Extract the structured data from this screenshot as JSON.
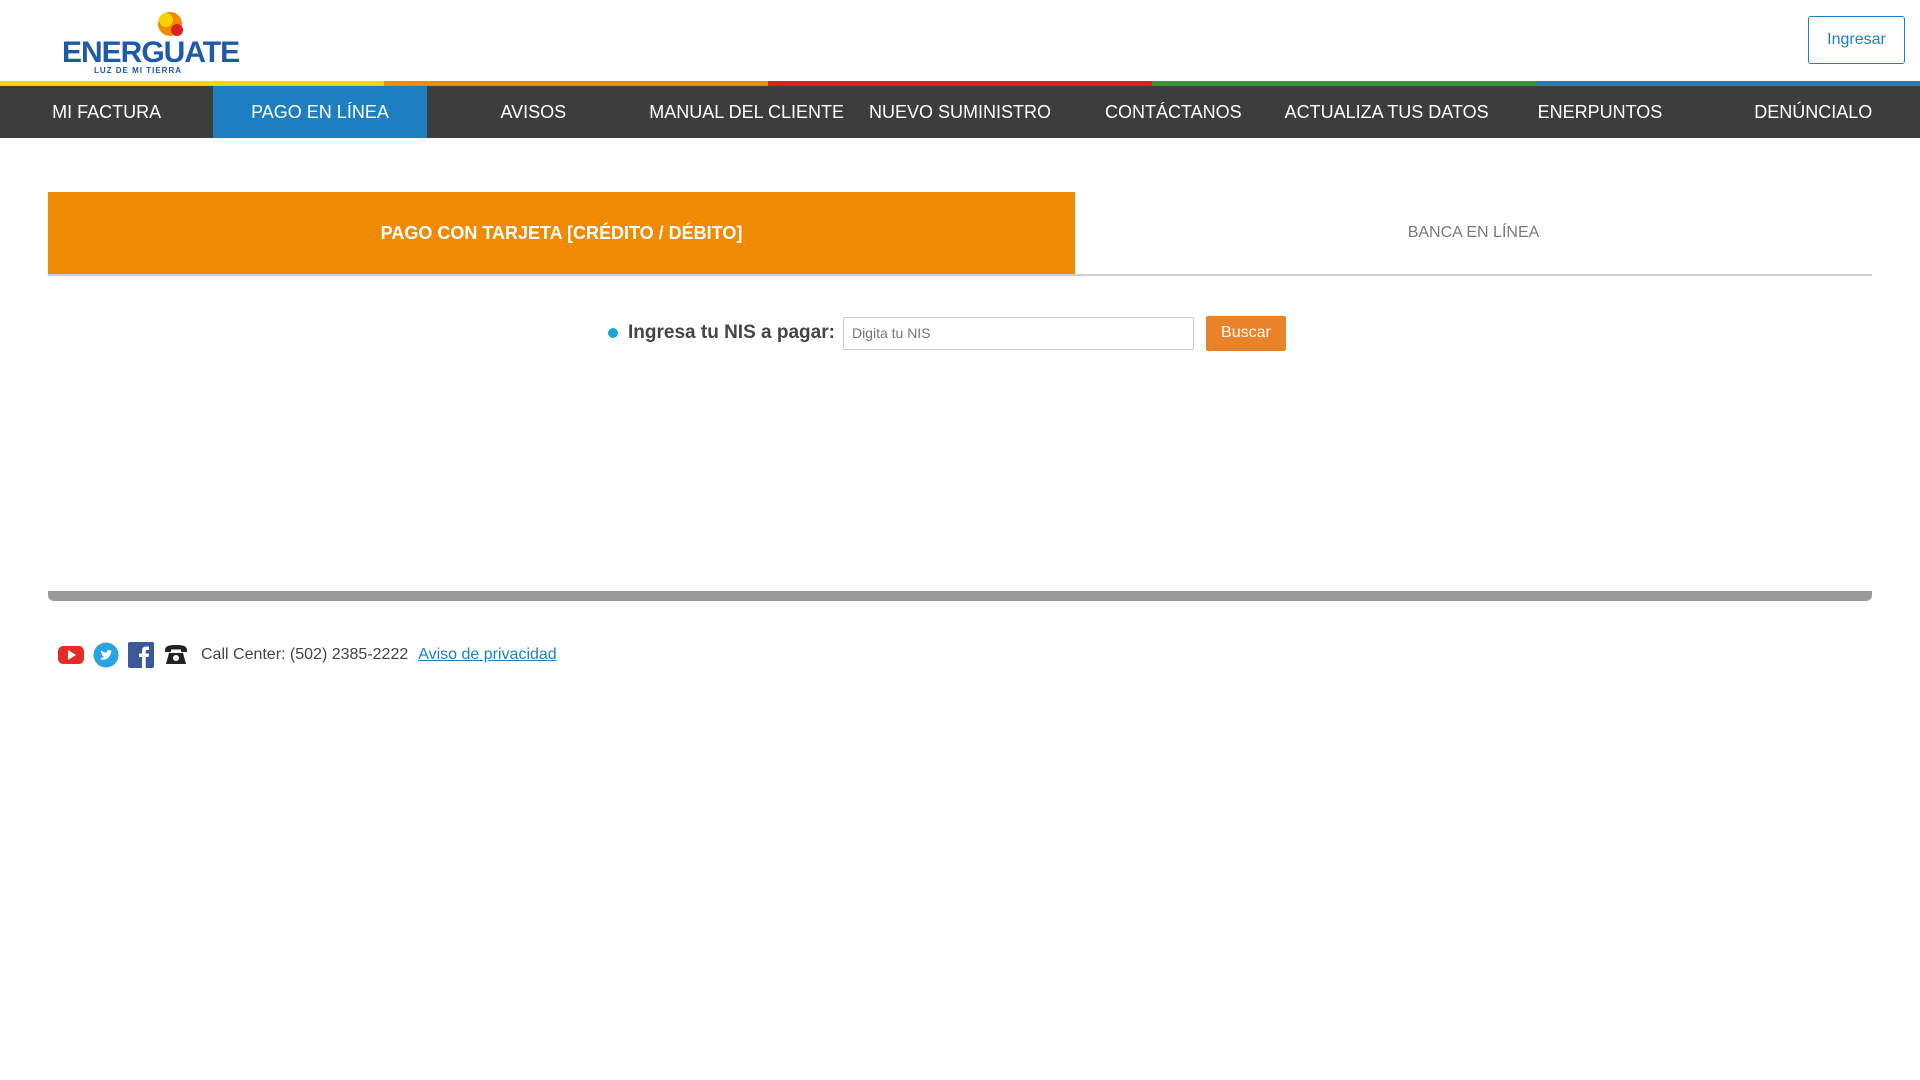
{
  "header": {
    "logo": {
      "name": "ENERGUATE",
      "tagline": "LUZ DE MI TIERRA"
    },
    "login_label": "Ingresar"
  },
  "strip_colors": [
    "#f5d300",
    "#f08a00",
    "#e02020",
    "#2a9a3a",
    "#1e7fc0"
  ],
  "nav": {
    "items": [
      {
        "label": "MI FACTURA",
        "active": false
      },
      {
        "label": "PAGO EN LÍNEA",
        "active": true
      },
      {
        "label": "AVISOS",
        "active": false
      },
      {
        "label": "MANUAL DEL CLIENTE",
        "active": false
      },
      {
        "label": "NUEVO SUMINISTRO",
        "active": false
      },
      {
        "label": "CONTÁCTANOS",
        "active": false
      },
      {
        "label": "ACTUALIZA TUS DATOS",
        "active": false
      },
      {
        "label": "ENERPUNTOS",
        "active": false
      },
      {
        "label": "DENÚNCIALO",
        "active": false
      }
    ]
  },
  "tabs": {
    "card": "PAGO CON TARJETA [CRÉDITO / DÉBITO]",
    "bank": "BANCA EN LÍNEA"
  },
  "form": {
    "label": "Ingresa tu NIS a pagar:",
    "placeholder": "Digita tu NIS",
    "value": "",
    "button": "Buscar"
  },
  "footer": {
    "icons": [
      "youtube-icon",
      "twitter-icon",
      "facebook-icon",
      "phone-icon"
    ],
    "call_center": "Call Center: (502) 2385-2222",
    "privacy": "Aviso de privacidad"
  },
  "colors": {
    "nav_bg": "#3d3d3d",
    "active_blue": "#1e7fc0",
    "tab_orange": "#f08a00",
    "button_orange": "#e8832a"
  }
}
